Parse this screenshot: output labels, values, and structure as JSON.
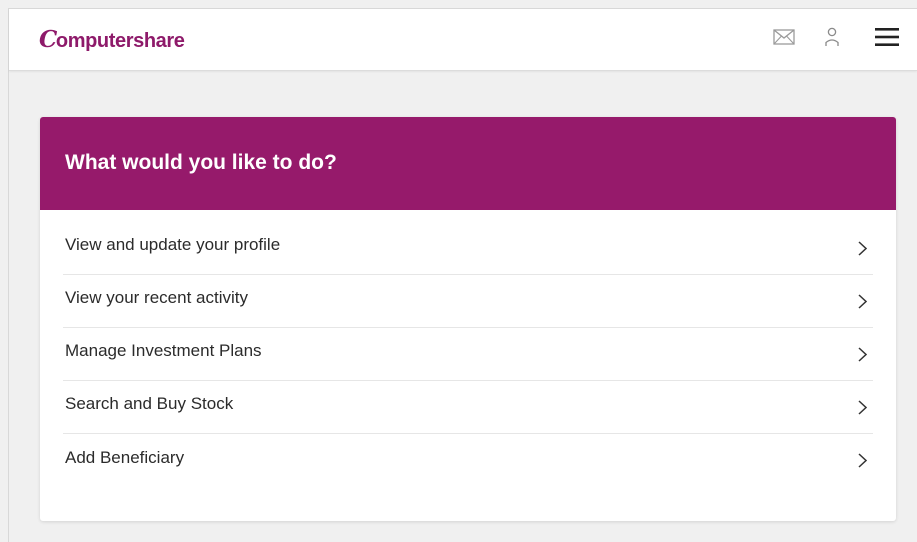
{
  "header": {
    "logo_text": "Computershare",
    "mail_icon": "mail-icon",
    "user_icon": "user-icon",
    "menu_icon": "menu-icon"
  },
  "card": {
    "title": "What would you like to do?",
    "items": [
      {
        "label": "View and update your profile",
        "icon": "chevron-right-icon"
      },
      {
        "label": "View your recent activity",
        "icon": "chevron-right-icon"
      },
      {
        "label": "Manage Investment Plans",
        "icon": "chevron-right-icon"
      },
      {
        "label": "Search and Buy Stock",
        "icon": "chevron-right-icon"
      },
      {
        "label": "Add Beneficiary",
        "icon": "chevron-right-icon"
      }
    ]
  },
  "colors": {
    "brand": "#961a6b",
    "page_background": "#f0f0f0",
    "text": "#2b2b2b"
  }
}
